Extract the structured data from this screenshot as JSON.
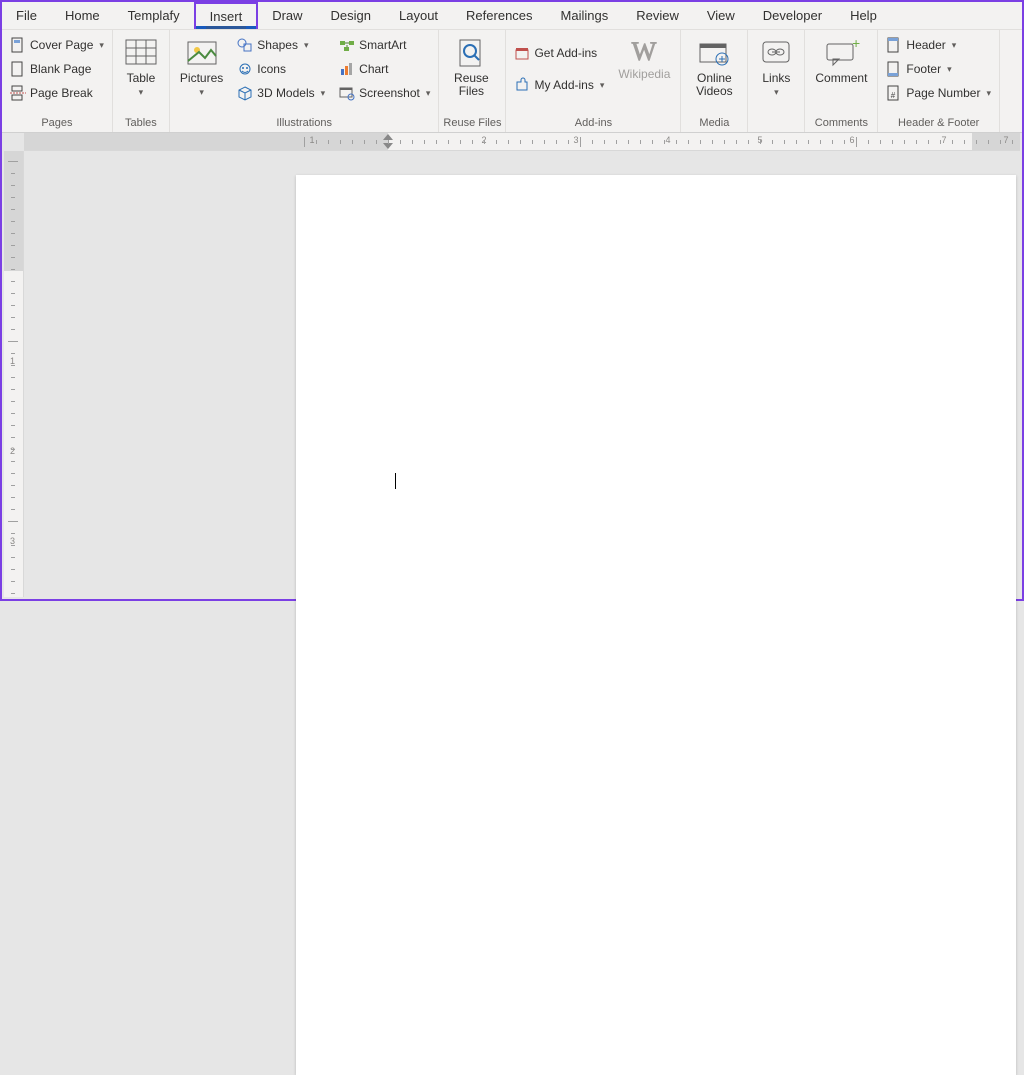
{
  "tabs": [
    "File",
    "Home",
    "Templafy",
    "Insert",
    "Draw",
    "Design",
    "Layout",
    "References",
    "Mailings",
    "Review",
    "View",
    "Developer",
    "Help"
  ],
  "active_tab_index": 3,
  "ribbon": {
    "pages": {
      "cover_page": "Cover Page",
      "blank_page": "Blank Page",
      "page_break": "Page Break",
      "group": "Pages"
    },
    "tables": {
      "table": "Table",
      "group": "Tables"
    },
    "illustrations": {
      "pictures": "Pictures",
      "shapes": "Shapes",
      "icons": "Icons",
      "models3d": "3D Models",
      "smartart": "SmartArt",
      "chart": "Chart",
      "screenshot": "Screenshot",
      "group": "Illustrations"
    },
    "reuse": {
      "reuse_files": "Reuse Files",
      "group": "Reuse Files"
    },
    "addins": {
      "get": "Get Add-ins",
      "mine": "My Add-ins",
      "wikipedia": "Wikipedia",
      "group": "Add-ins"
    },
    "media": {
      "online_videos": "Online Videos",
      "group": "Media"
    },
    "links": {
      "links": "Links"
    },
    "comments": {
      "comment": "Comment",
      "group": "Comments"
    },
    "headerfooter": {
      "header": "Header",
      "footer": "Footer",
      "page_number": "Page Number",
      "group": "Header & Footer"
    }
  },
  "ruler": {
    "numbers": [
      1,
      2,
      3,
      4,
      5,
      6,
      7
    ]
  }
}
